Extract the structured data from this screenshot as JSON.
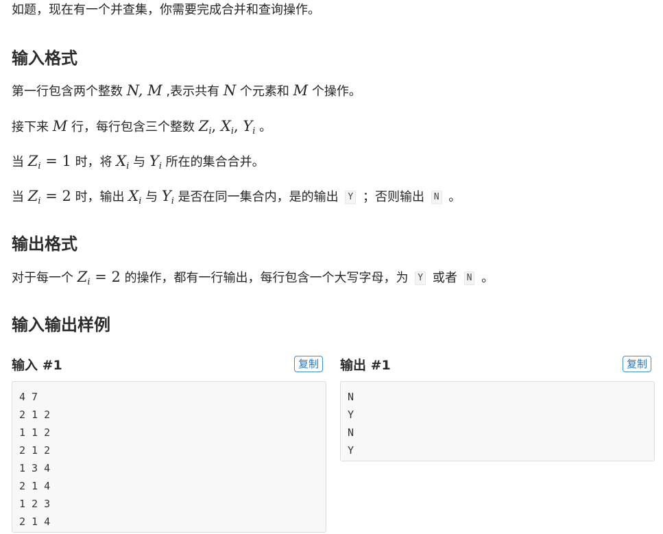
{
  "intro": "如题，现在有一个并查集，你需要完成合并和查询操作。",
  "input_format": {
    "heading": "输入格式",
    "line1": {
      "t1": "第一行包含两个整数",
      "m1": "N, M",
      "t2": ",表示共有",
      "m2": "N",
      "t3": "个元素和",
      "m3": "M",
      "t4": "个操作。"
    },
    "line2": {
      "t1": "接下来",
      "m1": "M",
      "t2": "行，每行包含三个整数",
      "z": "Z",
      "x": "X",
      "y": "Y",
      "i": "i",
      "comma": ",",
      "t3": "。"
    },
    "line3": {
      "t1": "当",
      "z": "Z",
      "i": "i",
      "eq": "= 1",
      "t2": "时，将",
      "x": "X",
      "t3": "与",
      "y": "Y",
      "t4": "所在的集合合并。"
    },
    "line4": {
      "t1": "当",
      "z": "Z",
      "i": "i",
      "eq": "= 2",
      "t2": "时，输出",
      "x": "X",
      "t3": "与",
      "y": "Y",
      "t4": "是否在同一集合内，是的输出",
      "c1": "Y",
      "t5": "；否则输出",
      "c2": "N",
      "t6": "。"
    }
  },
  "output_format": {
    "heading": "输出格式",
    "line1": {
      "t1": "对于每一个",
      "z": "Z",
      "i": "i",
      "eq": "= 2",
      "t2": "的操作，都有一行输出，每行包含一个大写字母，为",
      "c1": "Y",
      "t3": "或者",
      "c2": "N",
      "t4": "。"
    }
  },
  "samples": {
    "heading": "输入输出样例",
    "input_title": "输入 #1",
    "output_title": "输出 #1",
    "copy_label": "复制",
    "input_lines": [
      "4 7",
      "2 1 2",
      "1 1 2",
      "2 1 2",
      "1 3 4",
      "2 1 4",
      "1 2 3",
      "2 1 4"
    ],
    "output_lines": [
      "N",
      "Y",
      "N",
      "Y"
    ]
  }
}
